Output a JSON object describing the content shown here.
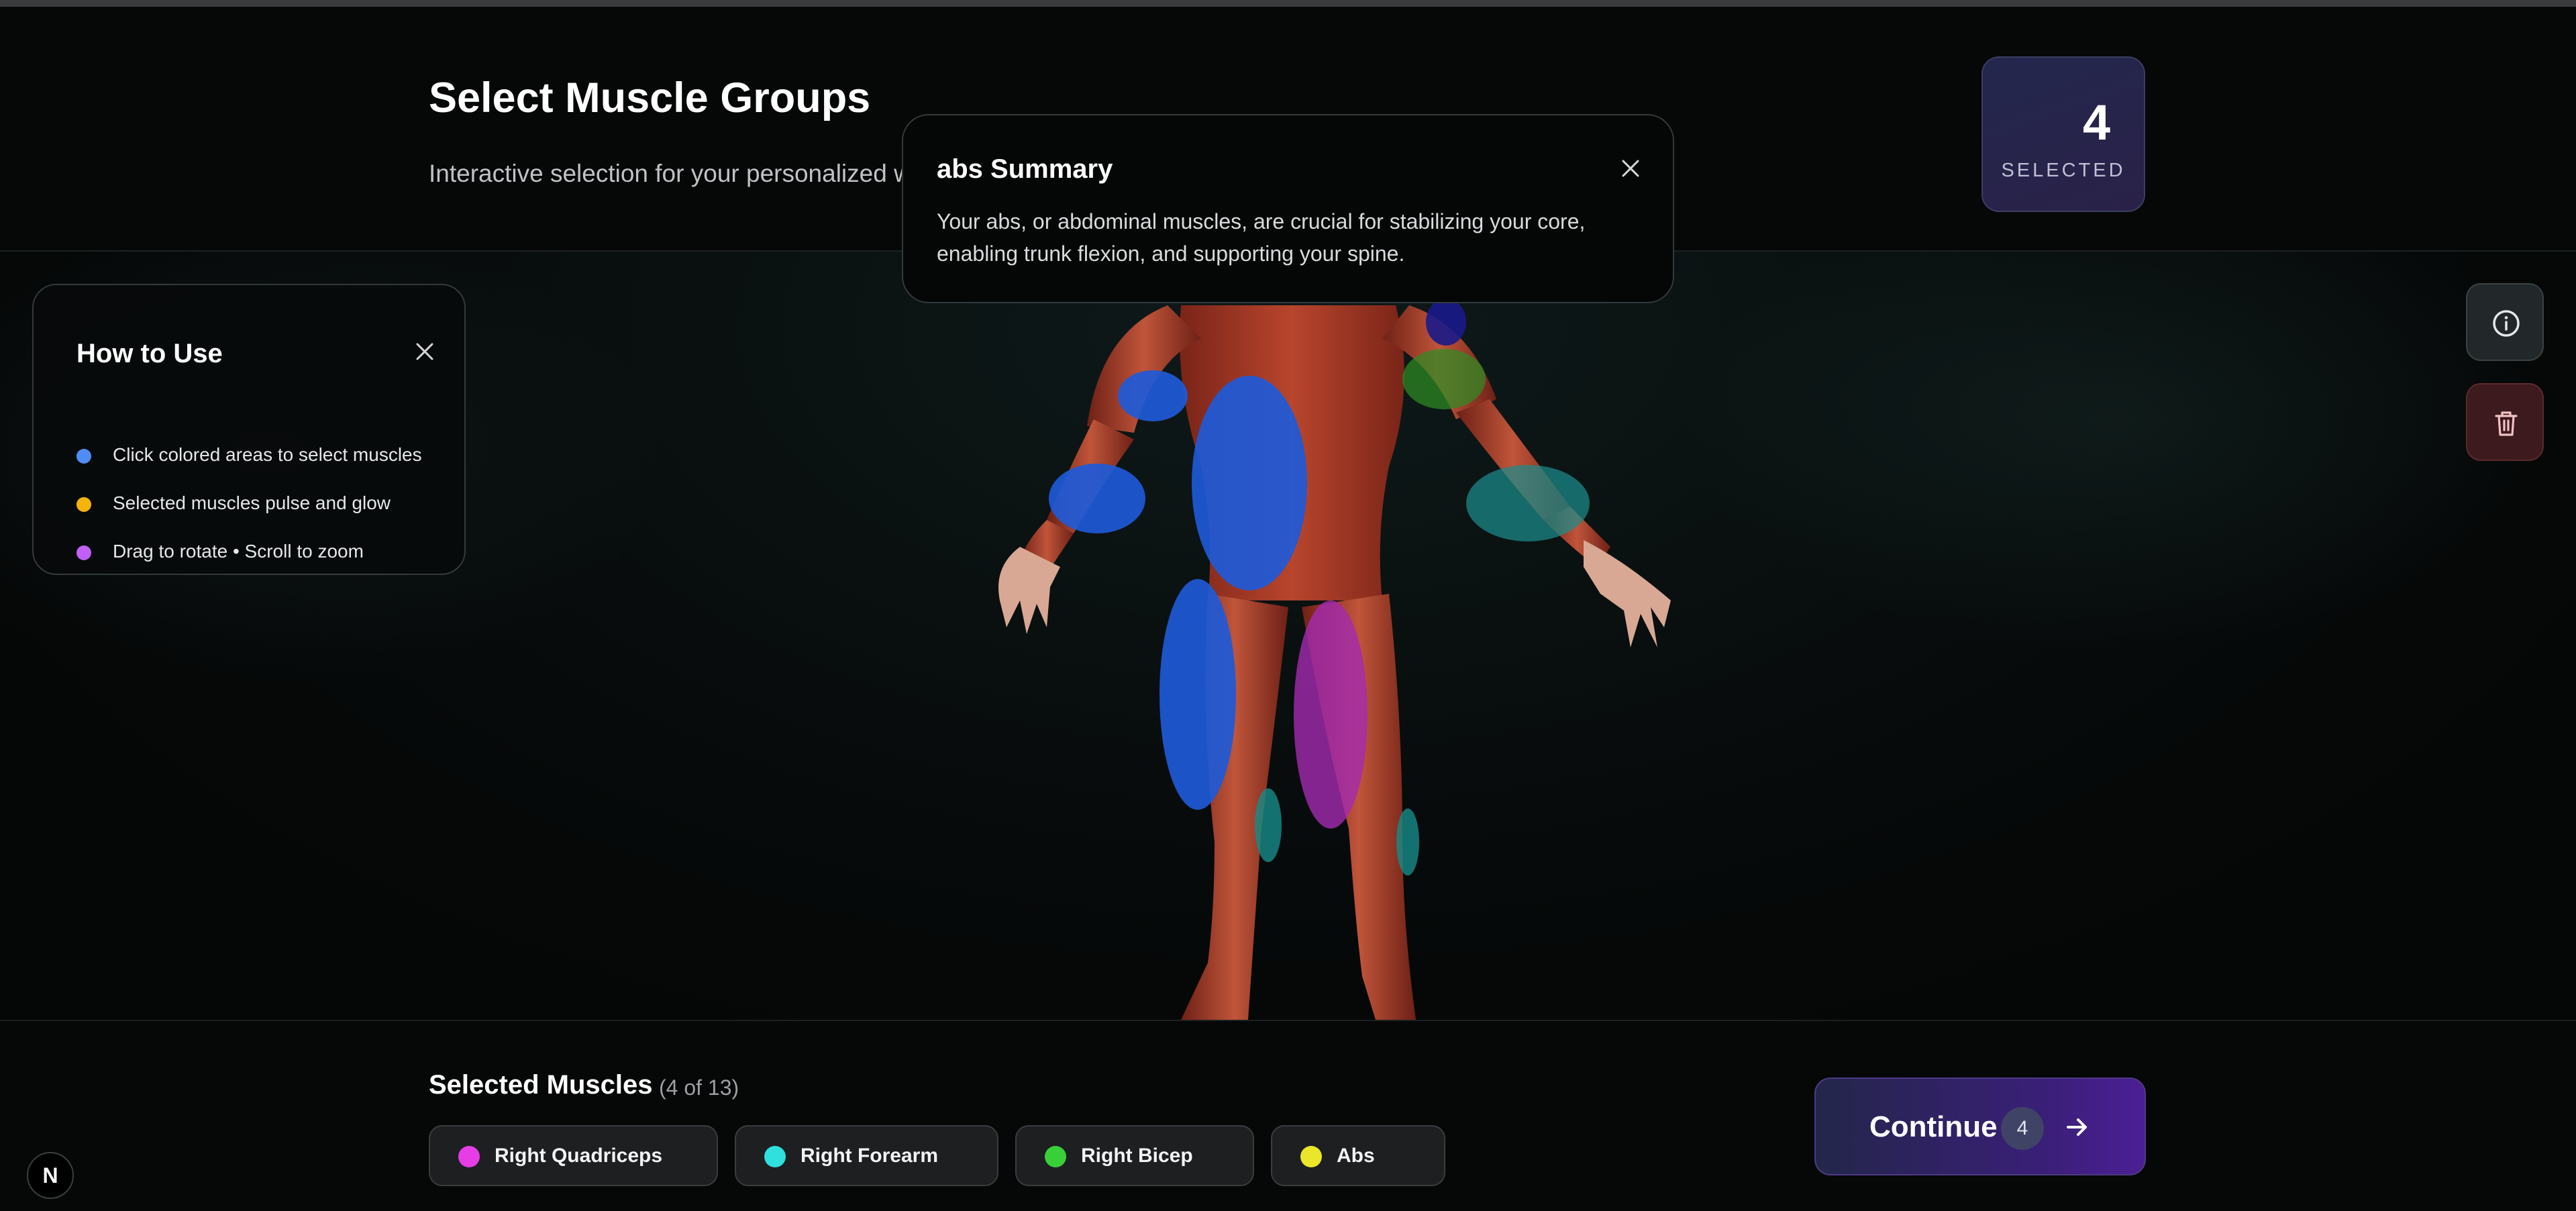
{
  "header": {
    "title": "Select Muscle Groups",
    "subtitle": "Interactive selection for your personalized workout"
  },
  "selected_card": {
    "count": "4",
    "label": "SELECTED"
  },
  "how_to": {
    "title": "How to Use",
    "items": [
      {
        "text": "Click colored areas to select muscles",
        "color": "#4f8df5"
      },
      {
        "text": "Selected muscles pulse and glow",
        "color": "#f5b40b"
      },
      {
        "text": "Drag to rotate • Scroll to zoom",
        "color": "#c060f5"
      }
    ]
  },
  "summary": {
    "title": "abs Summary",
    "body": "Your abs, or abdominal muscles, are crucial for stabilizing your core, enabling trunk flexion, and supporting your spine."
  },
  "selected_muscles": {
    "title": "Selected Muscles",
    "count_text": "(4 of 13)",
    "chips": [
      {
        "label": "Right Quadriceps",
        "color": "#e63de6"
      },
      {
        "label": "Right Forearm",
        "color": "#2fe0df"
      },
      {
        "label": "Right Bicep",
        "color": "#38d038"
      },
      {
        "label": "Abs",
        "color": "#ece62a"
      }
    ]
  },
  "continue_button": {
    "label": "Continue",
    "badge": "4"
  },
  "dev_badge": {
    "label": "N"
  },
  "icons": {
    "info": "info-circle-icon",
    "trash": "trash-icon",
    "close": "close-icon",
    "arrow": "arrow-right-icon"
  }
}
